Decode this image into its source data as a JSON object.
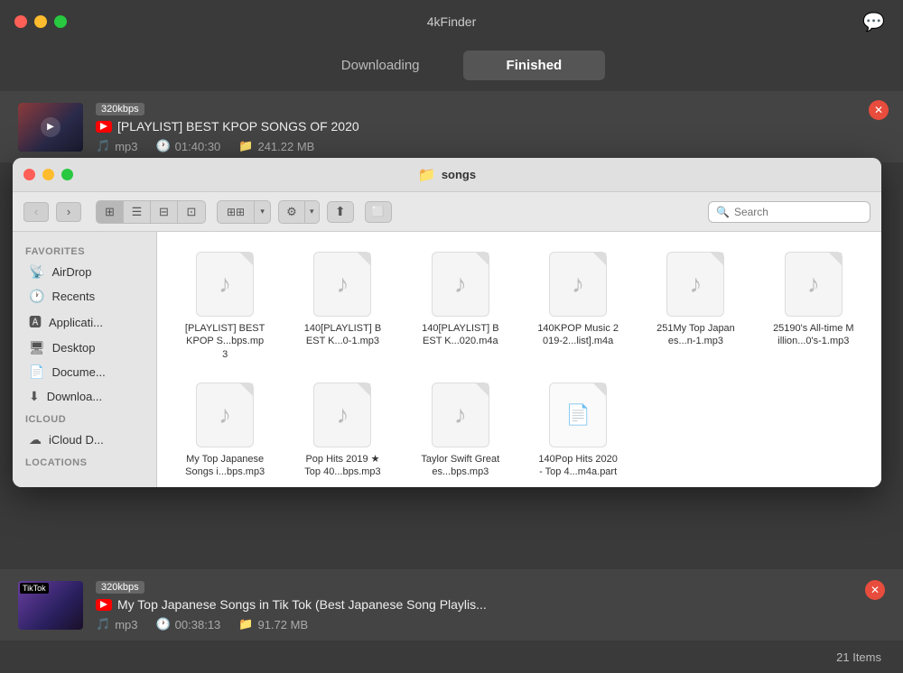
{
  "app": {
    "title": "4kFinder",
    "tabs": {
      "downloading": "Downloading",
      "finished": "Finished"
    },
    "active_tab": "finished"
  },
  "top_download": {
    "quality": "320kbps",
    "title": "[PLAYLIST] BEST KPOP SONGS OF 2020",
    "format": "mp3",
    "duration": "01:40:30",
    "size": "241.22 MB"
  },
  "finder": {
    "folder_name": "songs",
    "search_placeholder": "Search",
    "sidebar": {
      "favorites_label": "Favorites",
      "items": [
        {
          "label": "AirDrop",
          "icon": "📡"
        },
        {
          "label": "Recents",
          "icon": "🕐"
        },
        {
          "label": "Applicati...",
          "icon": "🅰"
        },
        {
          "label": "Desktop",
          "icon": "🖥"
        },
        {
          "label": "Docume...",
          "icon": "📄"
        },
        {
          "label": "Downloa...",
          "icon": "⬇"
        }
      ],
      "icloud_label": "iCloud",
      "icloud_items": [
        {
          "label": "iCloud D...",
          "icon": "☁"
        }
      ],
      "locations_label": "Locations"
    },
    "files": [
      {
        "name": "[PLAYLIST] BEST KPOP S...bps.mp3",
        "type": "mp3"
      },
      {
        "name": "140[PLAYLIST] BEST K...0-1.mp3",
        "type": "mp3"
      },
      {
        "name": "140[PLAYLIST] BEST K...020.m4a",
        "type": "m4a"
      },
      {
        "name": "140KPOP Music 2019-2...list].m4a",
        "type": "m4a"
      },
      {
        "name": "251My Top Japanes...n-1.mp3",
        "type": "mp3"
      },
      {
        "name": "25190's All-time Million...0's-1.mp3",
        "type": "mp3"
      },
      {
        "name": "My Top Japanese Songs i...bps.mp3",
        "type": "mp3"
      },
      {
        "name": "Pop  Hits 2019 ★ Top 40...bps.mp3",
        "type": "mp3"
      },
      {
        "name": "Taylor Swift Greates...bps.mp3",
        "type": "mp3"
      },
      {
        "name": "140Pop Hits 2020 - Top 4...m4a.part",
        "type": "part"
      }
    ]
  },
  "bottom_download": {
    "quality": "320kbps",
    "title": "My Top Japanese Songs in Tik Tok (Best Japanese Song Playlis...",
    "format": "mp3",
    "duration": "00:38:13",
    "size": "91.72 MB"
  },
  "status_bar": {
    "items_count": "21 Items"
  },
  "icons": {
    "close": "✕",
    "chevron_left": "‹",
    "chevron_right": "›",
    "chevron_down": "▾",
    "gear": "⚙",
    "share": "⬆",
    "search": "🔍",
    "music_note": "♪"
  }
}
